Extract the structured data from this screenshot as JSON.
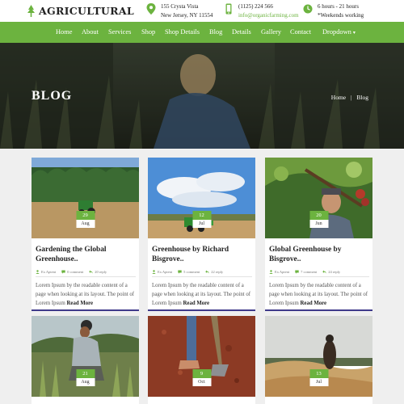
{
  "brand": {
    "name": "AGRICULTURAL"
  },
  "contact": {
    "address": {
      "line1": "155 Crysta Vista",
      "line2": "New Jersey, NY 11554"
    },
    "phone": {
      "line1": "(1125) 224 566",
      "line2": "info@organicfarming.com"
    },
    "hours": {
      "line1": "6 hours - 21 hours",
      "line2": "*Weekends working"
    }
  },
  "nav": {
    "items": [
      "Home",
      "About",
      "Services",
      "Shop",
      "Shop Details",
      "Blog",
      "Details",
      "Gallery",
      "Contact",
      "Dropdown"
    ]
  },
  "hero": {
    "title": "BLOG",
    "breadcrumb": {
      "home": "Home",
      "sep": "|",
      "current": "Blog"
    }
  },
  "posts": [
    {
      "day": "29",
      "month": "Aug",
      "title": "Gardening the Global Greenhouse..",
      "author": "Ex Aptent",
      "comments": "0 comment",
      "replies": "20 reply",
      "excerpt": "Lorem Ipsum by the readable content of a page when looking at its layout. The point of Lorem Ipsum",
      "more": "Read More"
    },
    {
      "day": "12",
      "month": "Jul",
      "title": "Greenhouse by Richard Bisgrove..",
      "author": "Ex Aptent",
      "comments": "5 comment",
      "replies": "22 reply",
      "excerpt": "Lorem Ipsum by the readable content of a page when looking at its layout. The point of Lorem Ipsum",
      "more": "Read More"
    },
    {
      "day": "20",
      "month": "Jun",
      "title": "Global Greenhouse by Bisgrove..",
      "author": "Ex Aptent",
      "comments": "7 comment",
      "replies": "24 reply",
      "excerpt": "Lorem Ipsum by the readable content of a page when looking at its layout. The point of Lorem Ipsum",
      "more": "Read More"
    },
    {
      "day": "21",
      "month": "Aug"
    },
    {
      "day": "9",
      "month": "Oct"
    },
    {
      "day": "13",
      "month": "Jul"
    }
  ],
  "colors": {
    "accent": "#6cb33f",
    "card_bar": "#3f3a8a",
    "background": "#efefef"
  },
  "icons": [
    "leaf-logo-icon",
    "map-marker-icon",
    "phone-icon",
    "clock-icon",
    "user-icon",
    "comment-icon",
    "reply-icon"
  ]
}
